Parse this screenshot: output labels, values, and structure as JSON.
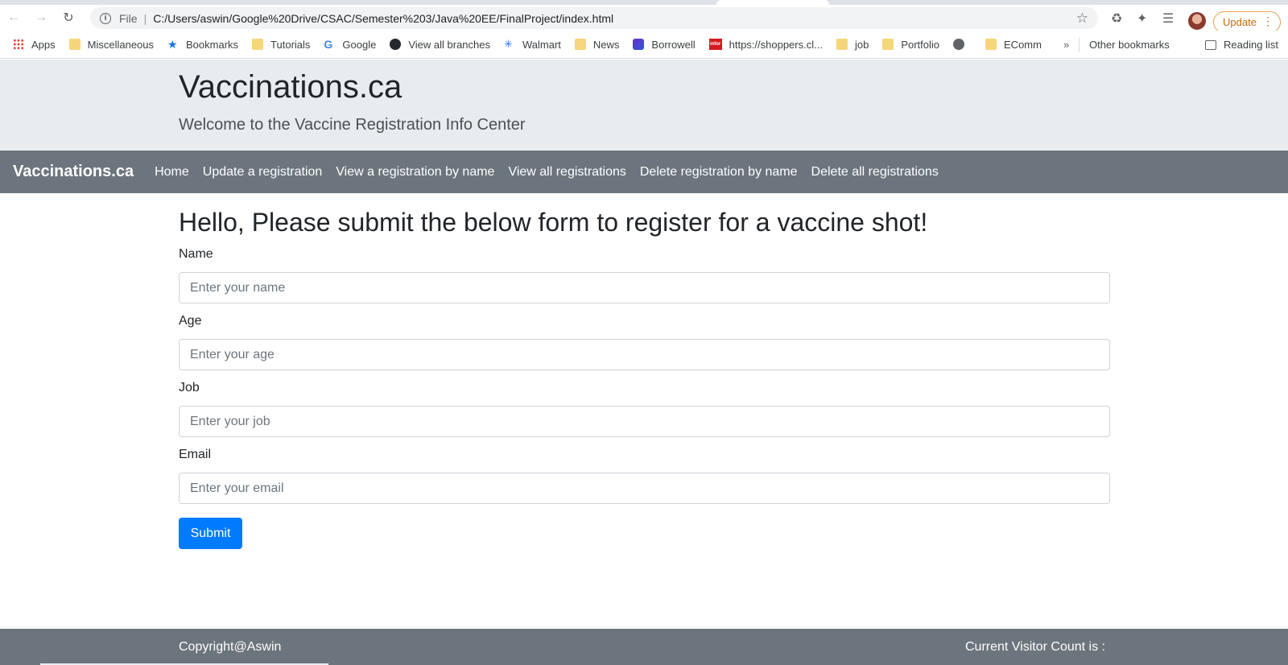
{
  "browser": {
    "omnibox": {
      "scheme_label": "File",
      "url": "C:/Users/aswin/Google%20Drive/CSAC/Semester%203/Java%20EE/FinalProject/index.html"
    },
    "update_label": "Update",
    "bookmarks": [
      {
        "label": "Apps",
        "icon": "apps-icon"
      },
      {
        "label": "Miscellaneous",
        "icon": "folder-icon"
      },
      {
        "label": "Bookmarks",
        "icon": "star-icon"
      },
      {
        "label": "Tutorials",
        "icon": "folder-icon"
      },
      {
        "label": "Google",
        "icon": "google-icon"
      },
      {
        "label": "View all branches",
        "icon": "github-icon"
      },
      {
        "label": "Walmart",
        "icon": "walmart-icon"
      },
      {
        "label": "News",
        "icon": "folder-icon"
      },
      {
        "label": "Borrowell",
        "icon": "borrowell-icon"
      },
      {
        "label": "https://shoppers.cl...",
        "icon": "infor-icon"
      },
      {
        "label": "job",
        "icon": "folder-icon"
      },
      {
        "label": "Portfolio",
        "icon": "folder-icon"
      },
      {
        "label": "",
        "icon": "globe-icon"
      },
      {
        "label": "EComm",
        "icon": "folder-icon"
      }
    ],
    "bookmarks_more": "»",
    "other_bookmarks": "Other bookmarks",
    "reading_list": "Reading list"
  },
  "header": {
    "title": "Vaccinations.ca",
    "subtitle": "Welcome to the Vaccine Registration Info Center"
  },
  "navbar": {
    "brand": "Vaccinations.ca",
    "links": [
      "Home",
      "Update a registration",
      "View a registration by name",
      "View all registrations",
      "Delete registration by name",
      "Delete all registrations"
    ]
  },
  "main": {
    "heading": "Hello, Please submit the below form to register for a vaccine shot!",
    "fields": [
      {
        "label": "Name",
        "placeholder": "Enter your name",
        "value": ""
      },
      {
        "label": "Age",
        "placeholder": "Enter your age",
        "value": ""
      },
      {
        "label": "Job",
        "placeholder": "Enter your job",
        "value": ""
      },
      {
        "label": "Email",
        "placeholder": "Enter your email",
        "value": ""
      }
    ],
    "submit_label": "Submit"
  },
  "footer": {
    "copyright": "Copyright@Aswin",
    "visitor_count_label": "Current Visitor Count is :"
  },
  "colors": {
    "jumbotron_bg": "#e9ecef",
    "navbar_bg": "#6c757d",
    "primary": "#007bff"
  }
}
